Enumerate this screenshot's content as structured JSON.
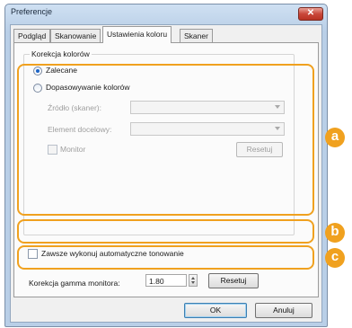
{
  "window": {
    "title": "Preferencje",
    "close_glyph": "✕"
  },
  "tabs": [
    {
      "label": "Podgląd"
    },
    {
      "label": "Skanowanie"
    },
    {
      "label": "Ustawienia koloru"
    },
    {
      "label": "Skaner"
    }
  ],
  "color_correction": {
    "group_label": "Korekcja kolorów",
    "recommended_label": "Zalecane",
    "color_matching_label": "Dopasowywanie kolorów",
    "source_label": "Źródło (skaner):",
    "source_value": "",
    "target_label": "Element docelowy:",
    "target_value": "",
    "monitor_label": "Monitor",
    "reset_label": "Resetuj"
  },
  "auto_tone_label": "Zawsze wykonuj automatyczne tonowanie",
  "gamma": {
    "label": "Korekcja gamma monitora:",
    "value": "1.80",
    "reset_label": "Resetuj"
  },
  "footer": {
    "ok_label": "OK",
    "cancel_label": "Anuluj"
  },
  "callouts": {
    "a": "a",
    "b": "b",
    "c": "c"
  },
  "colors": {
    "callout": "#f0a11f",
    "accent": "#1b64c6"
  }
}
